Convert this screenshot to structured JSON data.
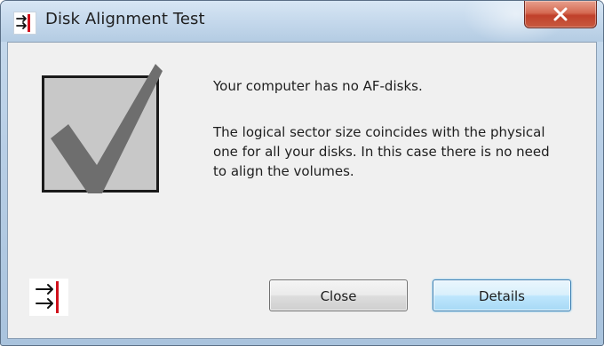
{
  "window": {
    "title": "Disk Alignment Test",
    "close_icon": "close-x-icon",
    "app_icon": "arrows-into-bar-icon"
  },
  "status_icon": "checkmark-icon",
  "message": {
    "headline": "Your computer has no AF-disks.",
    "line1": "The logical sector size coincides with the physical",
    "line2": "one for all your disks. In this case there is no need",
    "line3": "to align the volumes."
  },
  "buttons": {
    "close_label": "Close",
    "details_label": "Details"
  },
  "footer_icon": "arrows-into-bar-icon",
  "colors": {
    "accent_red": "#d0101c",
    "close_button_red": "#c0402a",
    "default_button_border": "#3c7fb1"
  }
}
